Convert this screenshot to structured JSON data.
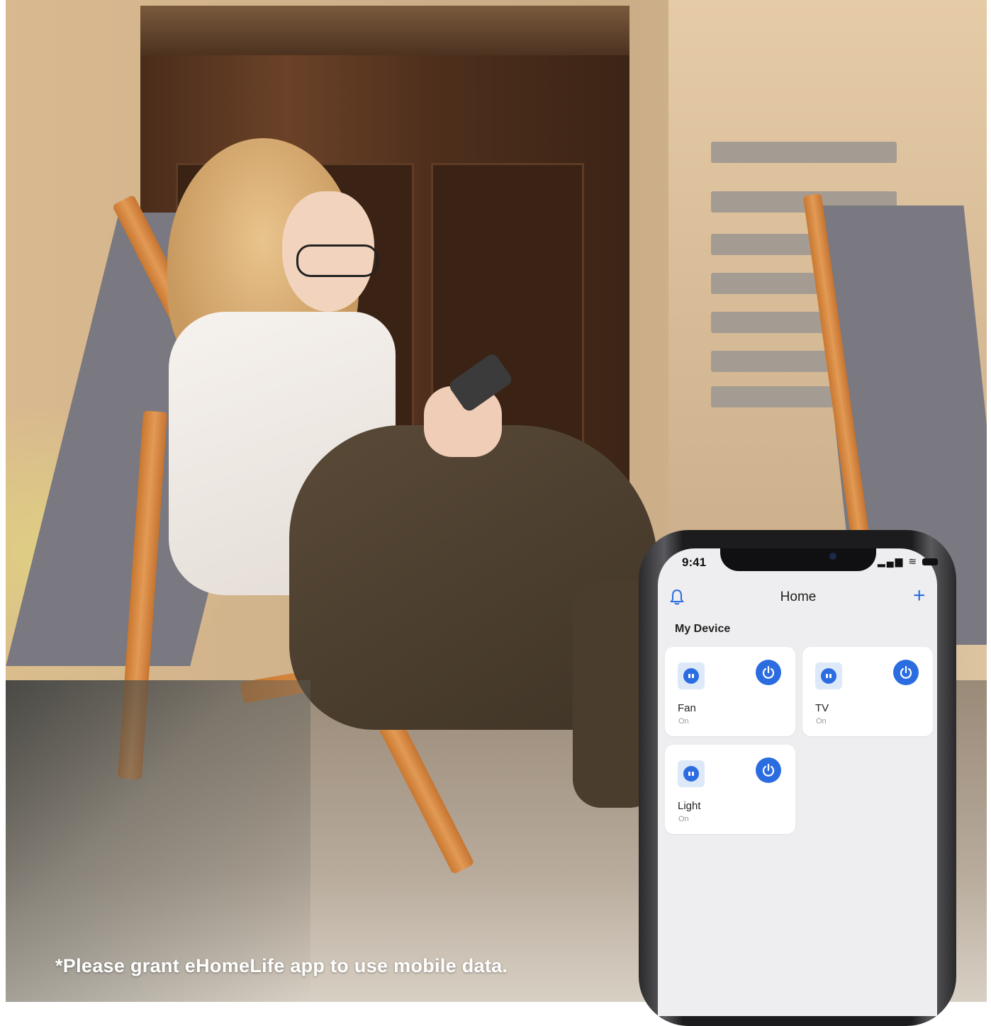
{
  "disclaimer": "*Please grant eHomeLife app to use mobile data.",
  "phone": {
    "status_time": "9:41",
    "title": "Home",
    "add_label": "+",
    "section_title": "My Device",
    "devices": [
      {
        "name": "Fan",
        "status": "On"
      },
      {
        "name": "TV",
        "status": "On"
      },
      {
        "name": "Light",
        "status": "On"
      }
    ]
  },
  "colors": {
    "accent": "#2b6de0",
    "screen_bg": "#eeeef0",
    "card_bg": "#ffffff"
  },
  "icons": [
    "bell-icon",
    "plus-icon",
    "plug-icon",
    "power-icon",
    "signal-icon",
    "wifi-icon",
    "battery-icon"
  ]
}
